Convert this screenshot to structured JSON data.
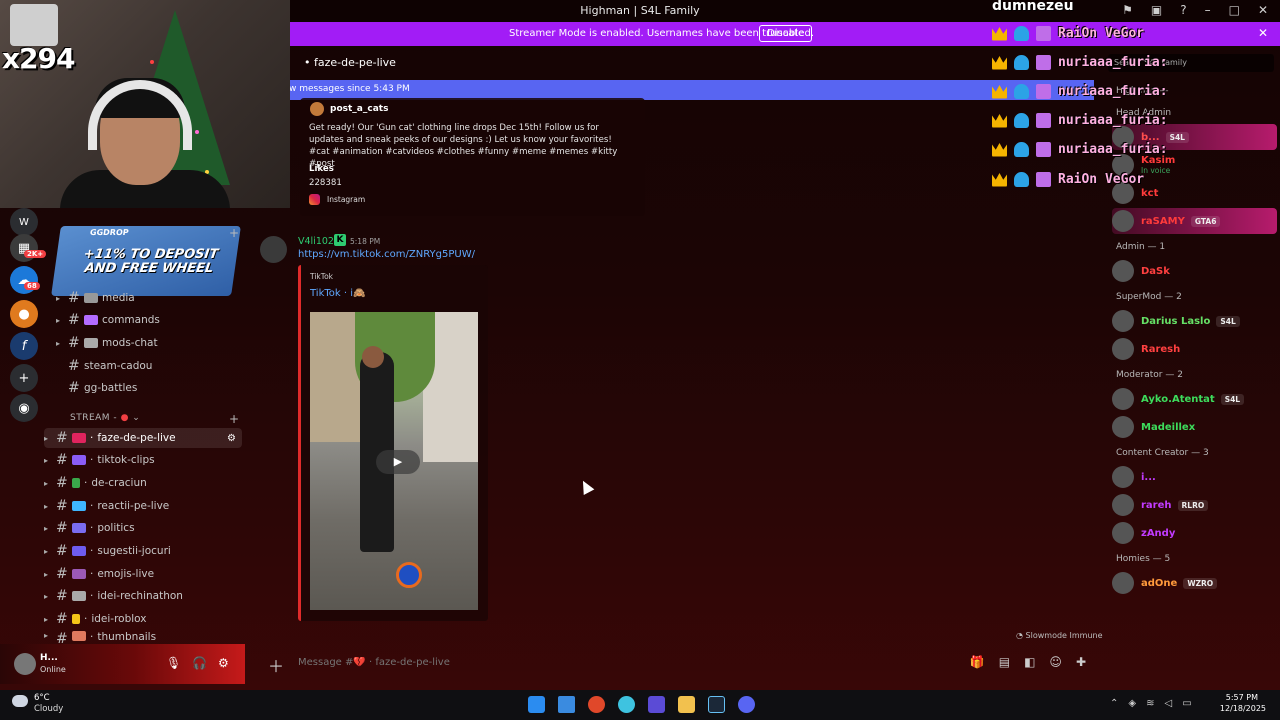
{
  "window": {
    "title": "Highman | S4L Family"
  },
  "banner": {
    "text": "Streamer Mode is enabled. Usernames have been truncated.",
    "disable_label": "Disable"
  },
  "webcam": {
    "gift_count": "x294"
  },
  "overlay": {
    "streamer_name": "dumnezeu",
    "messages": [
      "RaiOn VeGor",
      "nuriaaa_furia:",
      "nuriaaa_furia:",
      "nuriaaa_furia:",
      "nuriaaa_furia:",
      "RaiOn VeGor"
    ]
  },
  "rail": {
    "badges": [
      "2K+",
      "68"
    ]
  },
  "promo": {
    "brand": "GGDROP",
    "headline": "+11% TO DEPOSIT AND FREE WHEEL"
  },
  "channels": {
    "top": [
      {
        "name": "media"
      },
      {
        "name": "commands"
      },
      {
        "name": "mods-chat"
      },
      {
        "name": "steam-cadou"
      },
      {
        "name": "gg-battles"
      }
    ],
    "category": "STREAM -",
    "stream": [
      {
        "name": "faze-de-pe-live"
      },
      {
        "name": "tiktok-clips"
      },
      {
        "name": "de-craciun"
      },
      {
        "name": "reactii-pe-live"
      },
      {
        "name": "politics"
      },
      {
        "name": "sugestii-jocuri"
      },
      {
        "name": "emojis-live"
      },
      {
        "name": "idei-rechinathon"
      },
      {
        "name": "idei-roblox"
      },
      {
        "name": "thumbnails"
      }
    ]
  },
  "user": {
    "name": "H...",
    "status": "Online"
  },
  "header": {
    "channel": "faze-de-pe-live"
  },
  "new_messages_bar": "w messages since 5:43 PM",
  "embed1": {
    "author": "post_a_cats",
    "description": "Get ready! Our 'Gun cat' clothing line drops Dec 15th! Follow us for updates and sneak peeks of our designs :) Let us know your favorites! #cat #animation #catvideos #clothes #funny #meme #memes #kitty #post",
    "likes_label": "Likes",
    "likes": "228381",
    "footer": "Instagram"
  },
  "message2": {
    "author": "V4li102",
    "time": "5:18 PM",
    "link": "https://vm.tiktok.com/ZNRYg5PUW/",
    "embed": {
      "provider": "TikTok",
      "title": "TikTok · i🙈"
    }
  },
  "slowmode": "Slowmode Immune",
  "composer": {
    "placeholder": "Message #💔 · faze-de-pe-live"
  },
  "members": {
    "search_placeholder": "Search S4L Family",
    "groups": [
      {
        "role": "Highman —",
        "rows": []
      },
      {
        "role": "Head Admin",
        "rows": [
          {
            "name": "b...",
            "tag": "S4L",
            "color": "#ff4d4d",
            "sub": ""
          },
          {
            "name": "Kasim",
            "tag": "",
            "color": "#ff3b3b",
            "sub": "In voice"
          },
          {
            "name": "kct",
            "tag": "",
            "color": "#ff3b3b",
            "sub": ""
          },
          {
            "name": "raSAMY",
            "tag": "GTA6",
            "color": "#ff3b3b",
            "sub": ""
          }
        ]
      },
      {
        "role": "Admin — 1",
        "rows": [
          {
            "name": "DaSk",
            "tag": "",
            "color": "#ff4040",
            "sub": ""
          }
        ]
      },
      {
        "role": "SuperMod — 2",
        "rows": [
          {
            "name": "Darius Laslo",
            "tag": "S4L",
            "color": "#66e066",
            "sub": ""
          },
          {
            "name": "Raresh",
            "tag": "",
            "color": "#ff4040",
            "sub": ""
          }
        ]
      },
      {
        "role": "Moderator — 2",
        "rows": [
          {
            "name": "Ayko.Atentat",
            "tag": "S4L",
            "color": "#3ddc5c",
            "sub": ""
          },
          {
            "name": "Madeillex",
            "tag": "",
            "color": "#3ddc5c",
            "sub": ""
          }
        ]
      },
      {
        "role": "Content Creator — 3",
        "rows": [
          {
            "name": "i...",
            "tag": "",
            "color": "#c23bff",
            "sub": ""
          },
          {
            "name": "rareh",
            "tag": "RLRO",
            "color": "#c23bff",
            "sub": ""
          },
          {
            "name": "zAndy",
            "tag": "",
            "color": "#c23bff",
            "sub": ""
          }
        ]
      },
      {
        "role": "Homies — 5",
        "rows": [
          {
            "name": "adOne",
            "tag": "WZRO",
            "color": "#ff9a3c",
            "sub": ""
          }
        ]
      }
    ]
  },
  "taskbar": {
    "temp": "6°C",
    "weather": "Cloudy",
    "time": "5:57 PM",
    "date": "12/18/2025"
  },
  "colors": {
    "accent": "#5865f2",
    "banner": "#a21cf6",
    "link": "#5fa8ff"
  }
}
